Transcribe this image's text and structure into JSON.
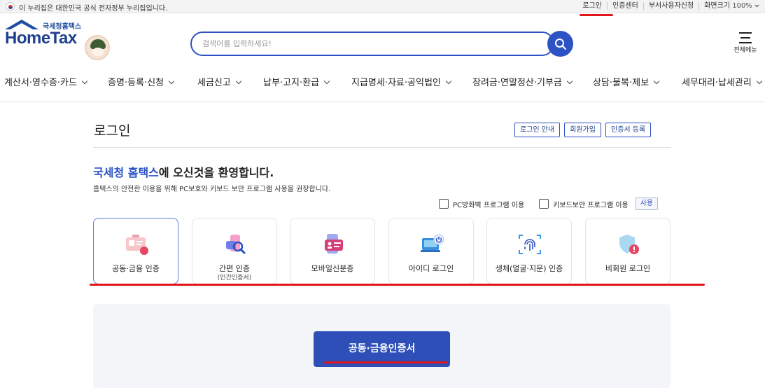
{
  "topbar": {
    "notice": "이 누리집은 대한민국 공식 전자정부 누리집입니다.",
    "links": [
      "로그인",
      "인증센터",
      "부서사용자신청"
    ],
    "zoom_label": "화면크기",
    "zoom_value": "100%"
  },
  "header": {
    "logo_ko": "국세청홈택스",
    "logo_en": "HomeTax",
    "search_placeholder": "검색어를 입력하세요!",
    "menu_all": "전체메뉴"
  },
  "gnb": [
    "계산서·영수증·카드",
    "증명·등록·신청",
    "세금신고",
    "납부·고지·환급",
    "지급명세·자료·공익법인",
    "장려금·연말정산·기부금",
    "상담·불복·제보",
    "세무대리·납세관리"
  ],
  "login": {
    "title": "로그인",
    "top_buttons": [
      "로그인 안내",
      "회원가입",
      "인증서 등록"
    ],
    "welcome_highlight": "국세청 홈택스",
    "welcome_rest": "에 오신것을 환영합니다.",
    "subtitle": "홈택스의 안전한 이용을 위해 PC보호와 키보드 보안 프로그램 사용을 권장합니다.",
    "options": [
      "PC방화벽 프로그램 이용",
      "키보드보안 프로그램 이용"
    ],
    "use_button": "사용",
    "methods": [
      {
        "label": "공동·금융 인증",
        "sub": "",
        "icon": "certificate-card-icon"
      },
      {
        "label": "간편 인증",
        "sub": "(민간인증서)",
        "icon": "simple-auth-icon"
      },
      {
        "label": "모바일신분증",
        "sub": "",
        "icon": "mobile-id-icon"
      },
      {
        "label": "아이디 로그인",
        "sub": "",
        "icon": "laptop-power-icon"
      },
      {
        "label": "생체(얼굴·지문) 인증",
        "sub": "",
        "icon": "fingerprint-icon"
      },
      {
        "label": "비회원 로그인",
        "sub": "",
        "icon": "shield-icon"
      }
    ],
    "cert_button": "공동·금융인증서"
  },
  "colors": {
    "primary": "#2d52c4",
    "annotation": "#e0161c",
    "panel_bg": "#f4f5f8"
  }
}
